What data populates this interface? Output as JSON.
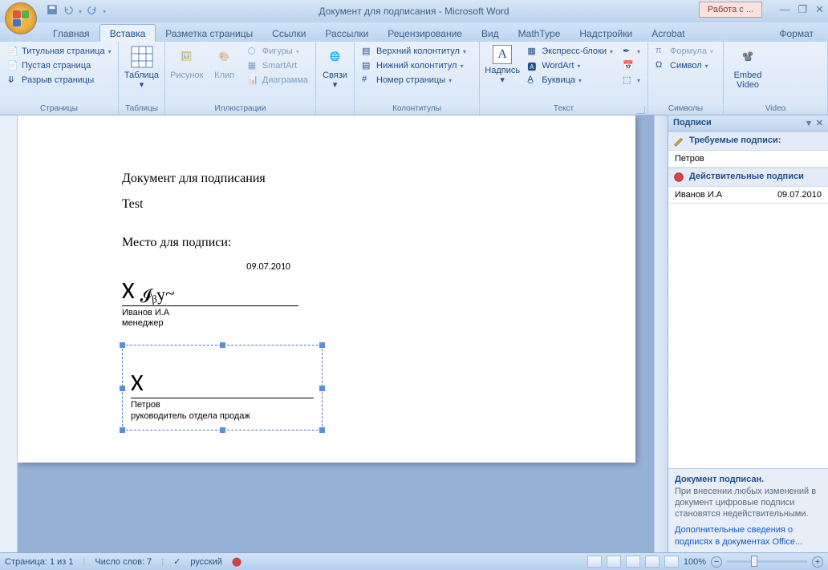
{
  "app": {
    "title": "Документ для подписания - Microsoft Word",
    "extra_tab": "Работа с ..."
  },
  "qat": {
    "save": "save",
    "undo": "undo",
    "redo": "redo"
  },
  "tabs": [
    "Главная",
    "Вставка",
    "Разметка страницы",
    "Ссылки",
    "Рассылки",
    "Рецензирование",
    "Вид",
    "MathType",
    "Надстройки",
    "Acrobat",
    "Формат"
  ],
  "active_tab": 1,
  "ribbon": {
    "pages": {
      "label": "Страницы",
      "cover": "Титульная страница",
      "blank": "Пустая страница",
      "break": "Разрыв страницы"
    },
    "tables": {
      "label": "Таблицы",
      "table": "Таблица"
    },
    "illus": {
      "label": "Иллюстрации",
      "picture": "Рисунок",
      "clip": "Клип",
      "shapes": "Фигуры",
      "smartart": "SmartArt",
      "chart": "Диаграмма"
    },
    "links": {
      "label": "",
      "links": "Связи"
    },
    "header": {
      "label": "Колонтитулы",
      "top": "Верхний колонтитул",
      "bottom": "Нижний колонтитул",
      "pagenum": "Номер страницы"
    },
    "text": {
      "label": "Текст",
      "textbox": "Надпись",
      "quick": "Экспресс-блоки",
      "wordart": "WordArt",
      "dropcap": "Буквица"
    },
    "symbols": {
      "label": "Символы",
      "formula": "Формула",
      "symbol": "Символ"
    },
    "video": {
      "label": "Video",
      "embed": "Embed Video"
    }
  },
  "doc": {
    "p1": "Документ для подписания",
    "p2": "Test",
    "p3": "Место для подписи:",
    "sig1": {
      "date": "09.07.2010",
      "x": "X",
      "name": "Иванов И.А",
      "role": "менеджер",
      "scribble": "Иву~"
    },
    "sig2": {
      "x": "X",
      "name": "Петров",
      "role": "руководитель отдела продаж"
    }
  },
  "pane": {
    "title": "Подписи",
    "required": "Требуемые подписи:",
    "req_item": "Петров",
    "valid": "Действительные подписи",
    "valid_item": "Иванов И.А",
    "valid_date": "09.07.2010",
    "signed": "Документ подписан.",
    "warn": "При внесении любых изменений в документ цифровые подписи становятся недействительными.",
    "link": "Дополнительные сведения о подписях в документах Office..."
  },
  "status": {
    "page": "Страница: 1 из 1",
    "words": "Число слов: 7",
    "lang": "русский",
    "zoom": "100%"
  }
}
